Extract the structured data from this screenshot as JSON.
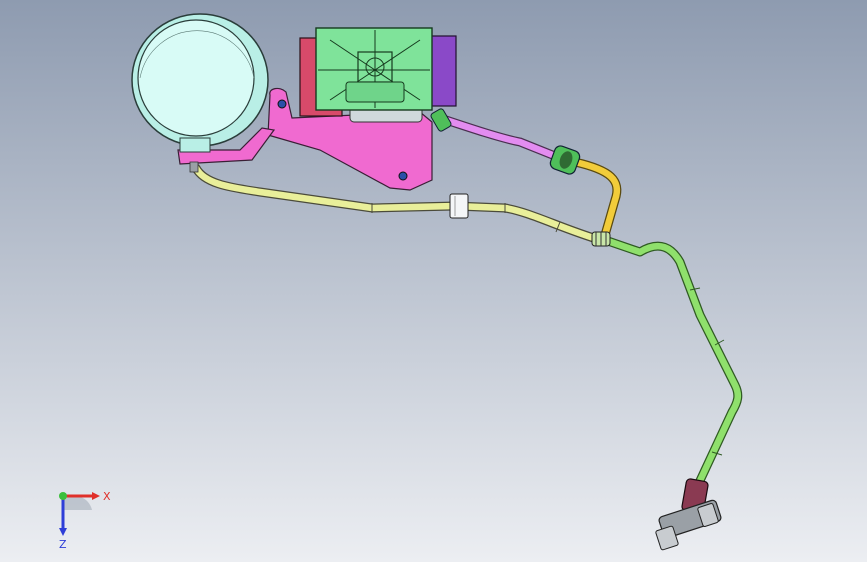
{
  "viewport": {
    "background_top": "#8e9bb0",
    "background_bottom": "#eceef2"
  },
  "model": {
    "colors": {
      "tank_face": "#d8fbf6",
      "tank_rim": "#b9efe6",
      "bracket": "#f06ad0",
      "bracket_dark": "#c4479f",
      "pump_green": "#7fe39a",
      "pump_red": "#d84a6a",
      "pump_purple": "#8a49c8",
      "hose_yellow_light": "#e9ef9a",
      "hose_yellow": "#f2cc3a",
      "hose_pink": "#e38cf0",
      "hose_green": "#8fe06c",
      "fitting_green": "#4fbf5a",
      "fitting_maroon": "#8a3a52",
      "fitting_grey": "#9aa0a6",
      "clip_white": "#f4f6f8",
      "bolt_blue": "#2a4fa8"
    }
  },
  "triad": {
    "x_label": "X",
    "z_label": "Z",
    "x_color": "#e0302a",
    "y_color": "#3bbf3b",
    "z_color": "#2e3ed8"
  }
}
